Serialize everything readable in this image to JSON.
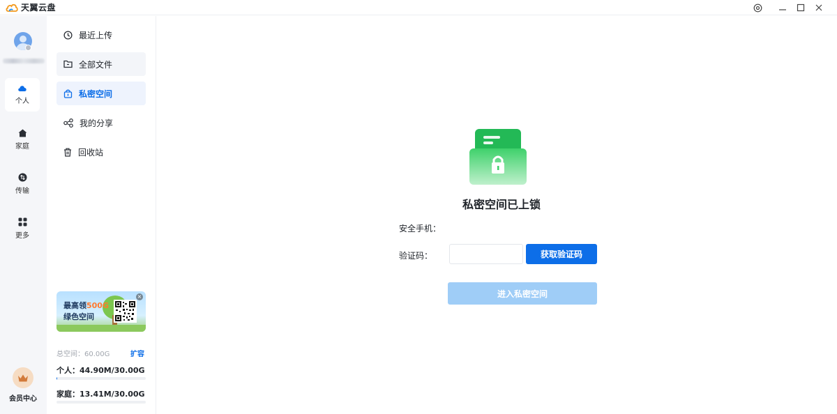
{
  "app": {
    "title": "天翼云盘"
  },
  "window_controls": {
    "settings_icon": "settings-icon",
    "minimize_icon": "minimize-icon",
    "maximize_icon": "maximize-icon",
    "close_icon": "close-icon"
  },
  "rail": {
    "items": [
      {
        "label": "个人",
        "icon": "cloud-icon",
        "active": true
      },
      {
        "label": "家庭",
        "icon": "home-icon",
        "active": false
      },
      {
        "label": "传输",
        "icon": "transfer-icon",
        "active": false
      },
      {
        "label": "更多",
        "icon": "grid-icon",
        "active": false
      }
    ],
    "vip_label": "会员中心"
  },
  "sidebar": {
    "items": [
      {
        "label": "最近上传",
        "icon": "clock-icon"
      },
      {
        "label": "全部文件",
        "icon": "folder-icon"
      },
      {
        "label": "私密空间",
        "icon": "lock-icon"
      },
      {
        "label": "我的分享",
        "icon": "share-icon"
      },
      {
        "label": "回收站",
        "icon": "trash-icon"
      }
    ],
    "active_index": 2,
    "promo": {
      "line1_prefix": "最高领",
      "line1_highlight": "500G",
      "line2": "绿色空间"
    },
    "storage": {
      "total": "总空间：60.00G",
      "expand": "扩容",
      "personal": "个人：44.90M/30.00G",
      "personal_fraction": 0.0015,
      "family": "家庭：13.41M/30.00G",
      "family_fraction": 0.0004
    }
  },
  "main": {
    "title": "私密空间已上锁",
    "phone_label": "安全手机：",
    "code_label": "验证码：",
    "code_value": "",
    "get_code_button": "获取验证码",
    "enter_button": "进入私密空间"
  },
  "colors": {
    "accent": "#0d6ee8",
    "disabled_button": "#9fcdf7",
    "lock_green": "#2fc45f"
  }
}
